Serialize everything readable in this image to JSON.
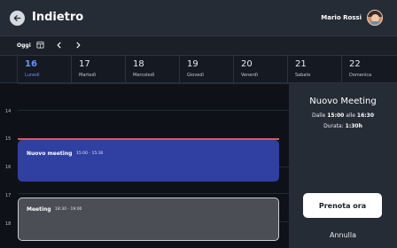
{
  "header": {
    "title": "Indietro",
    "user_name": "Mario Rossi"
  },
  "toolbar": {
    "today_label": "Oggi"
  },
  "days": [
    {
      "num": "16",
      "name": "Lunedì",
      "active": true
    },
    {
      "num": "17",
      "name": "Martedì",
      "active": false
    },
    {
      "num": "18",
      "name": "Mercoledì",
      "active": false
    },
    {
      "num": "19",
      "name": "Giovedì",
      "active": false
    },
    {
      "num": "20",
      "name": "Venerdì",
      "active": false
    },
    {
      "num": "21",
      "name": "Sabato",
      "active": false
    },
    {
      "num": "22",
      "name": "Domenica",
      "active": false
    }
  ],
  "hours": [
    "14",
    "15",
    "16",
    "17",
    "18"
  ],
  "events": {
    "new": {
      "title": "Nuovo meeting",
      "time": "15:00 - 15:30"
    },
    "existing": {
      "title": "Meeting",
      "time": "18:30 - 19:00"
    }
  },
  "side": {
    "title": "Nuovo Meeting",
    "from_label": "Dalle",
    "from_time": "15:00",
    "to_label": "alle",
    "to_time": "16:30",
    "duration_label": "Durata:",
    "duration_value": "1:30h",
    "book_label": "Prenota ora",
    "cancel_label": "Annulla"
  },
  "colors": {
    "accent": "#6f8ff7",
    "event_new": "#2f3fa2",
    "now_line": "#e0555a"
  }
}
